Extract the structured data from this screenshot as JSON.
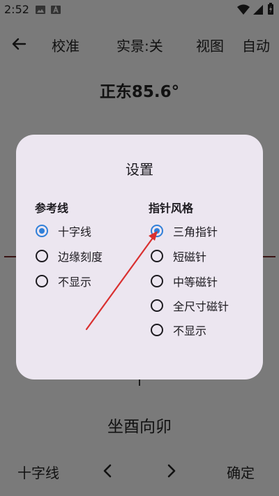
{
  "status": {
    "time": "2:52"
  },
  "toolbar": {
    "calibrate": "校准",
    "live_view": "实景:关",
    "view": "视图",
    "auto": "自动"
  },
  "heading": "正东85.6°",
  "dialog": {
    "title": "设置",
    "reference_line": {
      "title": "参考线",
      "options": [
        "十字线",
        "边缘刻度",
        "不显示"
      ],
      "selected": "十字线"
    },
    "pointer_style": {
      "title": "指针风格",
      "options": [
        "三角指针",
        "短磁针",
        "中等磁针",
        "全尺寸磁针",
        "不显示"
      ],
      "selected": "三角指针"
    }
  },
  "direction_text": "坐酉向卯",
  "bottombar": {
    "current": "十字线",
    "confirm": "确定"
  },
  "colors": {
    "accent": "#2f7fd9",
    "dialog_bg": "#ece6f0",
    "backdrop": "#7a7a7a",
    "annotation_arrow": "#d93030"
  }
}
